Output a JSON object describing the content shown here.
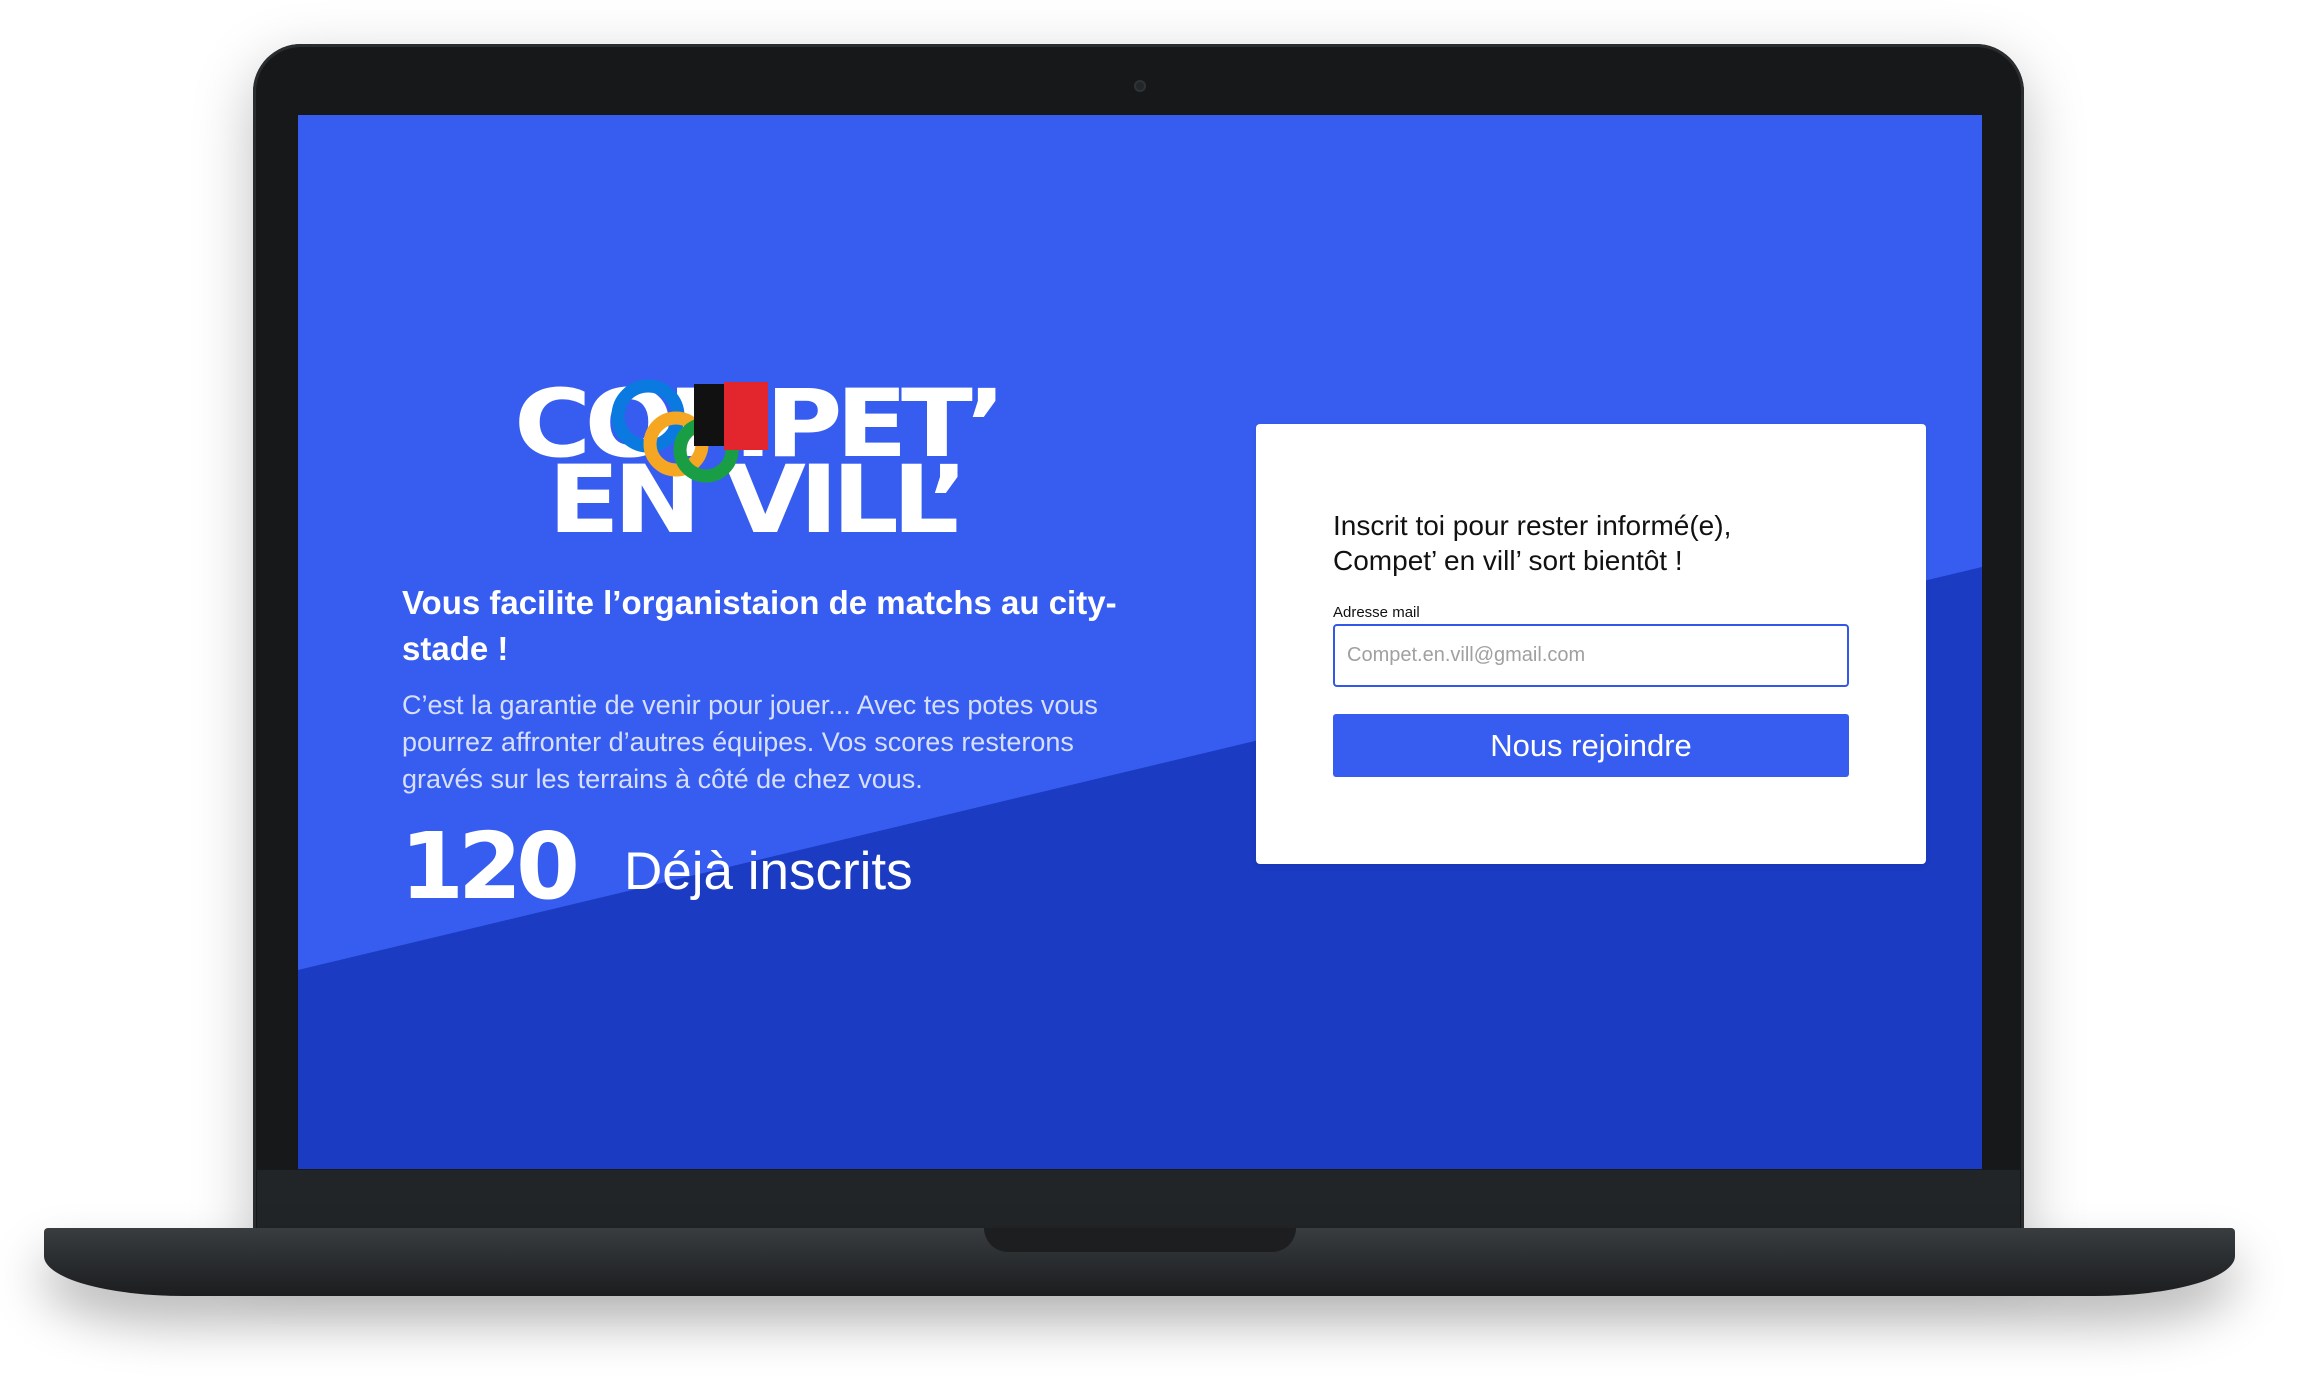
{
  "logo": {
    "line1": "COMPET’",
    "line2": "EN VILL’",
    "ring_colors": [
      "#0a7ae0",
      "#f5a623",
      "#111111",
      "#1a9e45",
      "#e3262e"
    ]
  },
  "hero": {
    "headline": "Vous facilite l’organistaion de matchs au city-stade !",
    "description": "C’est la garantie de venir pour jouer... Avec tes potes vous pourrez affronter d’autres équipes. Vos scores resterons gravés sur les terrains à côté de chez vous.",
    "count": "120",
    "count_label": "Déjà inscrits"
  },
  "signup": {
    "title_line1": "Inscrit toi pour rester informé(e),",
    "title_line2": "Compet’ en vill’ sort bientôt !",
    "email_label": "Adresse mail",
    "email_placeholder": "Compet.en.vill@gmail.com",
    "email_value": "",
    "submit_label": "Nous rejoindre"
  },
  "colors": {
    "primary": "#375df0",
    "primary_dark": "#1a3bc2",
    "card_bg": "#ffffff"
  }
}
